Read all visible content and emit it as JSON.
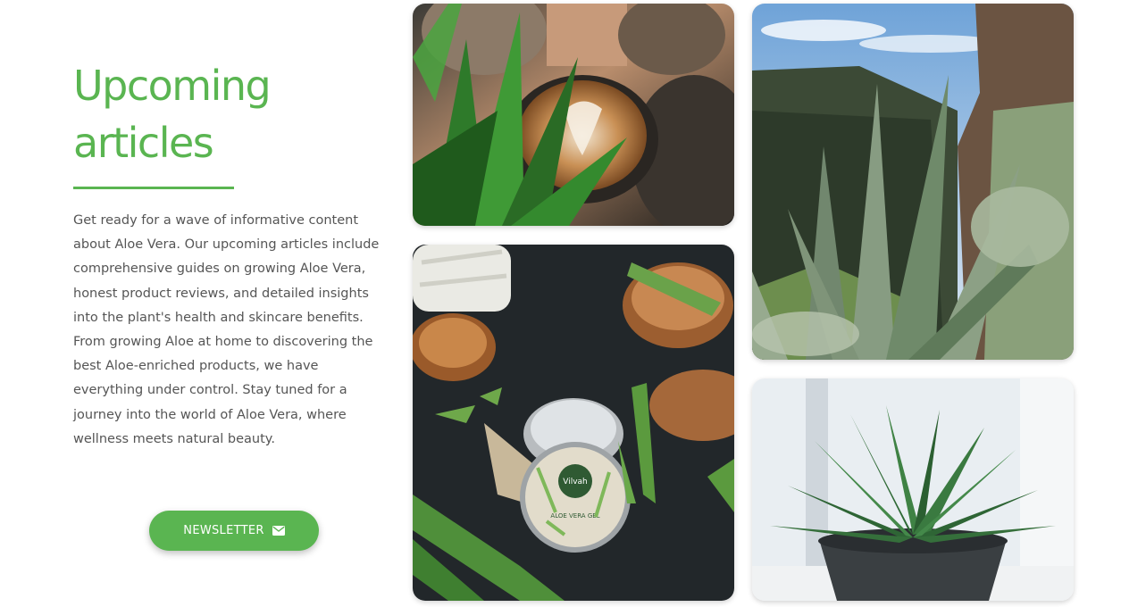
{
  "section": {
    "title_line1": "Upcoming",
    "title_line2": "articles",
    "description": "Get ready for a wave of informative content about Aloe Vera. Our upcoming articles include comprehensive guides on growing Aloe Vera, honest product reviews, and detailed insights into the plant's health and skincare benefits. From growing Aloe at home to discovering the best Aloe-enriched products, we have everything under control. Stay tuned for a journey into the world of Aloe Vera, where wellness meets natural beauty.",
    "button_label": "NEWSLETTER",
    "button_icon": "envelope-icon"
  },
  "colors": {
    "accent": "#5ab551",
    "text": "#555555",
    "background": "#ffffff"
  },
  "gallery": {
    "jar_label_brand": "Vilvah",
    "jar_label_product": "ALOE VERA GEL"
  }
}
